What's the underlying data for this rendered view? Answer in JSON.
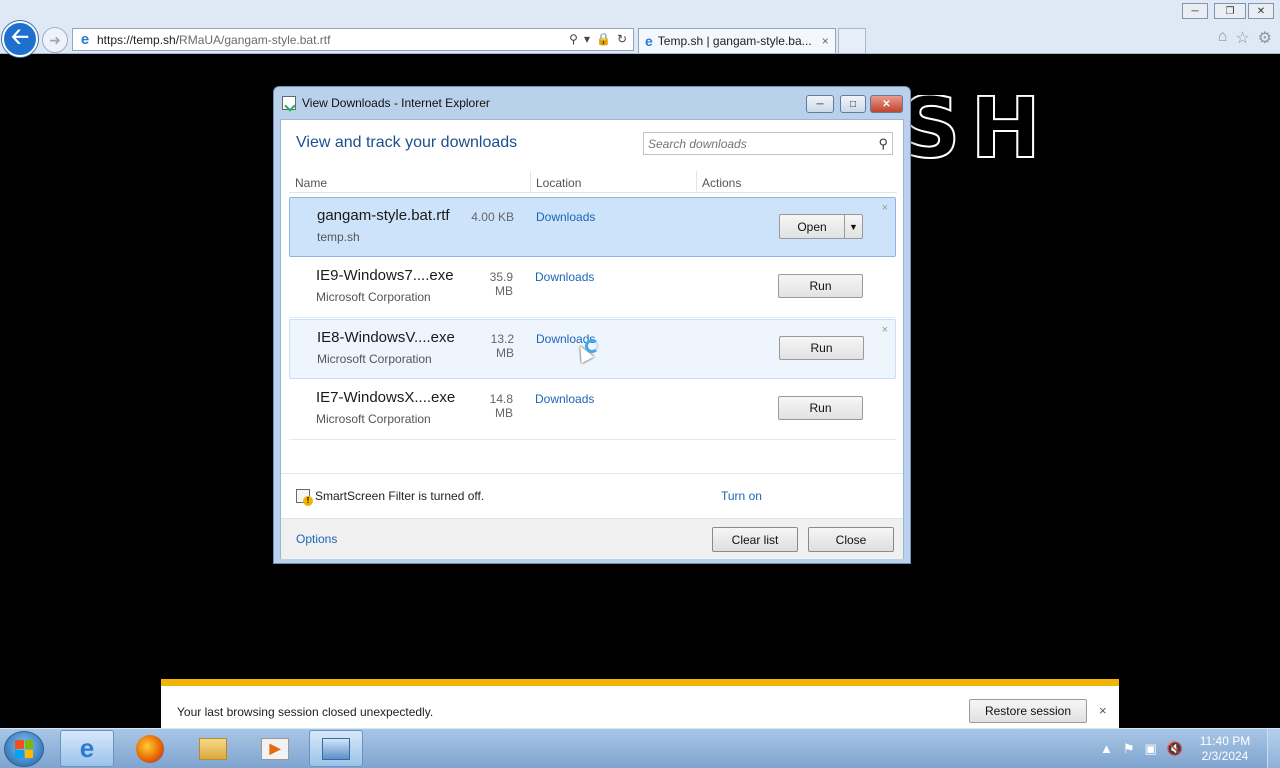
{
  "browser": {
    "url_host": "https://temp.sh/",
    "url_path": "RMaUA/gangam-style.bat.rtf",
    "tab_title": "Temp.sh | gangam-style.ba...",
    "tab_close": "×"
  },
  "page": {
    "letters": "SH"
  },
  "dialog": {
    "title": "View Downloads - Internet Explorer",
    "heading": "View and track your downloads",
    "search_placeholder": "Search downloads",
    "columns": {
      "name": "Name",
      "location": "Location",
      "actions": "Actions"
    },
    "downloads": [
      {
        "name": "gangam-style.bat.rtf",
        "size": "4.00 KB",
        "location": "Downloads",
        "source": "temp.sh",
        "action": "Open"
      },
      {
        "name": "IE9-Windows7....exe",
        "size": "35.9 MB",
        "location": "Downloads",
        "source": "Microsoft Corporation",
        "action": "Run"
      },
      {
        "name": "IE8-WindowsV....exe",
        "size": "13.2 MB",
        "location": "Downloads",
        "source": "Microsoft Corporation",
        "action": "Run"
      },
      {
        "name": "IE7-WindowsX....exe",
        "size": "14.8 MB",
        "location": "Downloads",
        "source": "Microsoft Corporation",
        "action": "Run"
      }
    ],
    "remove_glyph": "×",
    "smartscreen_text": "SmartScreen Filter is turned off.",
    "smartscreen_link": "Turn on",
    "options_link": "Options",
    "clear_list": "Clear list",
    "close": "Close"
  },
  "notification": {
    "message": "Your last browsing session closed unexpectedly.",
    "restore_button": "Restore session",
    "close_glyph": "×"
  },
  "taskbar": {
    "time": "11:40 PM",
    "date": "2/3/2024"
  },
  "icons": {
    "back": "arrow-left-icon",
    "forward": "arrow-right-icon",
    "search": "magnifier-icon",
    "lock": "lock-icon",
    "refresh": "refresh-icon",
    "home": "home-icon",
    "favorites": "star-icon",
    "settings": "gear-icon"
  },
  "colors": {
    "link": "#1b66b8",
    "heading": "#1d4e8f",
    "selected_row": "#cde3fa",
    "notification_accent": "#f1b400"
  }
}
